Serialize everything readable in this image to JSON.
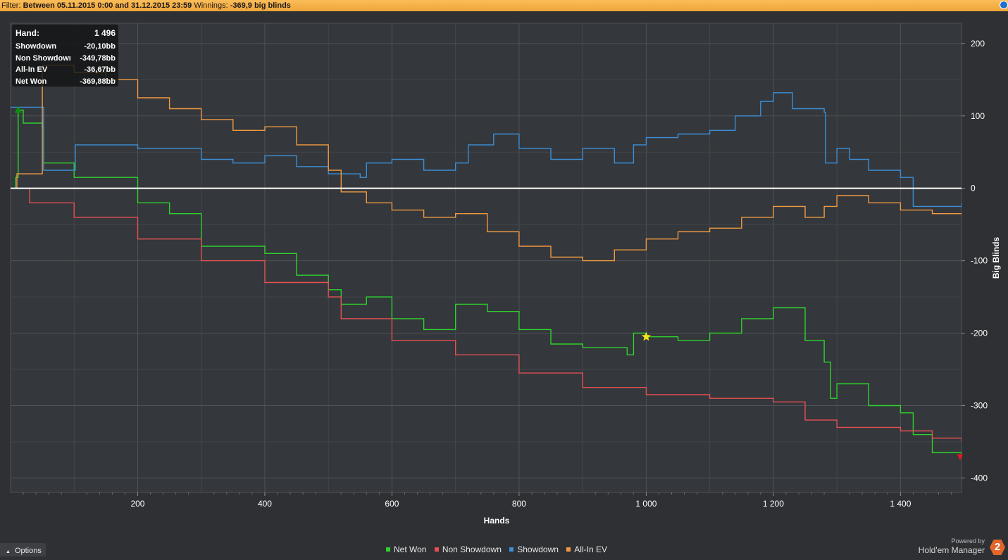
{
  "filter": {
    "label": "Filter:",
    "range": "Between 05.11.2015 0:00 and 31.12.2015 23:59",
    "winnings_label": "Winnings:",
    "winnings_value": "-369,9 big blinds"
  },
  "tooltip": {
    "rows": [
      {
        "label": "Hand:",
        "value": "1 496"
      },
      {
        "label": "Showdown",
        "value": "-20,10bb"
      },
      {
        "label": "Non Showdown",
        "value": "-349,78bb"
      },
      {
        "label": "All-In EV",
        "value": "-36,67bb"
      },
      {
        "label": "Net Won",
        "value": "-369,88bb"
      }
    ]
  },
  "options_label": "Options",
  "powered_by": "Powered by",
  "brand_name": "Hold'em Manager",
  "brand_badge": "2",
  "chart_data": {
    "type": "line",
    "xlabel": "Hands",
    "ylabel": "Big Blinds",
    "xlim": [
      0,
      1496
    ],
    "ylim": [
      -420,
      228
    ],
    "xticks": [
      200,
      400,
      600,
      800,
      1000,
      1200,
      1400
    ],
    "xtick_labels": [
      "200",
      "400",
      "600",
      "800",
      "1 000",
      "1 200",
      "1 400"
    ],
    "yticks": [
      200,
      100,
      0,
      -100,
      -200,
      -300,
      -400
    ],
    "ytick_labels": [
      "200",
      "100",
      "0",
      "-100",
      "-200",
      "-300",
      "-400"
    ],
    "grid": true,
    "legend_position": "bottom-center",
    "series": [
      {
        "name": "Net Won",
        "color": "#2fd12f",
        "points": [
          [
            0,
            0
          ],
          [
            8,
            15
          ],
          [
            12,
            108
          ],
          [
            20,
            90
          ],
          [
            50,
            85
          ],
          [
            52,
            35
          ],
          [
            100,
            15
          ],
          [
            200,
            -20
          ],
          [
            250,
            -35
          ],
          [
            300,
            -80
          ],
          [
            400,
            -90
          ],
          [
            450,
            -120
          ],
          [
            500,
            -140
          ],
          [
            520,
            -160
          ],
          [
            560,
            -150
          ],
          [
            600,
            -180
          ],
          [
            650,
            -195
          ],
          [
            700,
            -160
          ],
          [
            750,
            -170
          ],
          [
            800,
            -195
          ],
          [
            850,
            -215
          ],
          [
            900,
            -220
          ],
          [
            970,
            -230
          ],
          [
            980,
            -200
          ],
          [
            1000,
            -205
          ],
          [
            1050,
            -210
          ],
          [
            1100,
            -200
          ],
          [
            1150,
            -180
          ],
          [
            1200,
            -165
          ],
          [
            1250,
            -210
          ],
          [
            1280,
            -240
          ],
          [
            1290,
            -290
          ],
          [
            1300,
            -270
          ],
          [
            1350,
            -300
          ],
          [
            1400,
            -310
          ],
          [
            1420,
            -340
          ],
          [
            1450,
            -365
          ],
          [
            1496,
            -370
          ]
        ]
      },
      {
        "name": "Non Showdown",
        "color": "#e65054",
        "points": [
          [
            0,
            0
          ],
          [
            30,
            -20
          ],
          [
            100,
            -40
          ],
          [
            200,
            -70
          ],
          [
            300,
            -100
          ],
          [
            400,
            -130
          ],
          [
            500,
            -150
          ],
          [
            520,
            -180
          ],
          [
            600,
            -210
          ],
          [
            700,
            -230
          ],
          [
            800,
            -255
          ],
          [
            900,
            -275
          ],
          [
            1000,
            -285
          ],
          [
            1100,
            -290
          ],
          [
            1200,
            -295
          ],
          [
            1250,
            -320
          ],
          [
            1300,
            -330
          ],
          [
            1400,
            -335
          ],
          [
            1450,
            -345
          ],
          [
            1496,
            -350
          ]
        ]
      },
      {
        "name": "Showdown",
        "color": "#3a8fd8",
        "points": [
          [
            0,
            112
          ],
          [
            50,
            112
          ],
          [
            52,
            25
          ],
          [
            100,
            25
          ],
          [
            102,
            60
          ],
          [
            150,
            60
          ],
          [
            200,
            55
          ],
          [
            250,
            55
          ],
          [
            300,
            40
          ],
          [
            350,
            35
          ],
          [
            400,
            45
          ],
          [
            450,
            30
          ],
          [
            500,
            20
          ],
          [
            550,
            15
          ],
          [
            560,
            35
          ],
          [
            600,
            40
          ],
          [
            650,
            25
          ],
          [
            700,
            35
          ],
          [
            720,
            60
          ],
          [
            760,
            75
          ],
          [
            800,
            55
          ],
          [
            850,
            40
          ],
          [
            900,
            55
          ],
          [
            950,
            35
          ],
          [
            980,
            60
          ],
          [
            1000,
            70
          ],
          [
            1050,
            75
          ],
          [
            1100,
            80
          ],
          [
            1140,
            100
          ],
          [
            1180,
            120
          ],
          [
            1200,
            132
          ],
          [
            1230,
            110
          ],
          [
            1280,
            105
          ],
          [
            1282,
            35
          ],
          [
            1300,
            55
          ],
          [
            1320,
            40
          ],
          [
            1350,
            25
          ],
          [
            1400,
            15
          ],
          [
            1420,
            -25
          ],
          [
            1496,
            -20
          ]
        ]
      },
      {
        "name": "All-In EV",
        "color": "#f19a43",
        "points": [
          [
            0,
            0
          ],
          [
            10,
            20
          ],
          [
            50,
            170
          ],
          [
            100,
            160
          ],
          [
            150,
            150
          ],
          [
            200,
            125
          ],
          [
            250,
            110
          ],
          [
            300,
            95
          ],
          [
            350,
            80
          ],
          [
            400,
            85
          ],
          [
            450,
            60
          ],
          [
            500,
            25
          ],
          [
            520,
            -5
          ],
          [
            560,
            -20
          ],
          [
            600,
            -30
          ],
          [
            650,
            -40
          ],
          [
            700,
            -35
          ],
          [
            750,
            -60
          ],
          [
            800,
            -80
          ],
          [
            850,
            -95
          ],
          [
            900,
            -100
          ],
          [
            950,
            -85
          ],
          [
            1000,
            -70
          ],
          [
            1050,
            -60
          ],
          [
            1100,
            -55
          ],
          [
            1150,
            -40
          ],
          [
            1200,
            -25
          ],
          [
            1250,
            -40
          ],
          [
            1280,
            -25
          ],
          [
            1300,
            -10
          ],
          [
            1350,
            -20
          ],
          [
            1400,
            -30
          ],
          [
            1450,
            -35
          ],
          [
            1496,
            -36
          ]
        ]
      }
    ],
    "baseline": 0,
    "markers": [
      {
        "symbol": "triangle-up",
        "color": "#0d8f0d",
        "x": 12,
        "y": 108
      },
      {
        "symbol": "star",
        "color": "#f5e31b",
        "x": 1000,
        "y": -205
      },
      {
        "symbol": "triangle-down",
        "color": "#e01a1a",
        "x": 1496,
        "y": -372
      }
    ]
  }
}
